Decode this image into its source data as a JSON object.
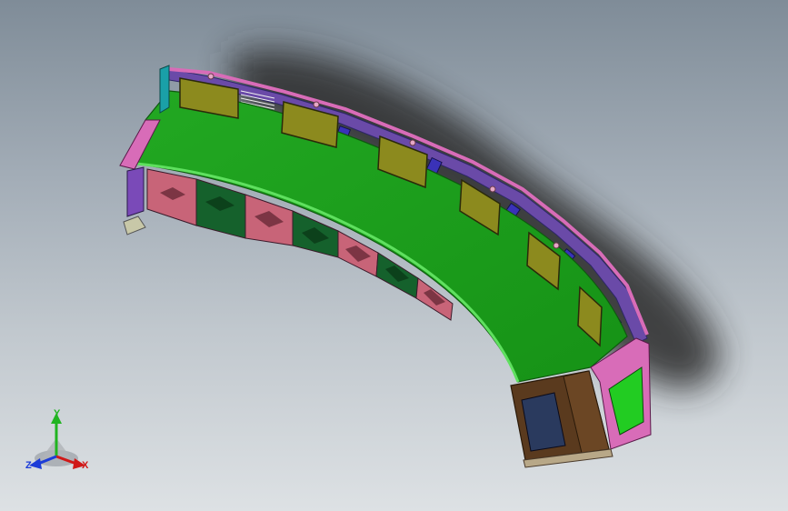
{
  "viewport": {
    "background_top": "#7f8c98",
    "background_bottom": "#dde1e4"
  },
  "model": {
    "desk_top_color": "#1e9e1e",
    "edge_trim_color": "#d86cb8",
    "panel_pink_color": "#c86478",
    "panel_green_color": "#15612c",
    "monitor_color": "#8c8a1e",
    "end_cabinet_color": "#5a3a1e",
    "rail_color": "#3a32b8"
  },
  "triad": {
    "y_label": "Y",
    "x_label": "X",
    "z_label": "Z",
    "y_color": "#21b421",
    "x_color": "#d01818",
    "z_color": "#1c3cd8"
  }
}
